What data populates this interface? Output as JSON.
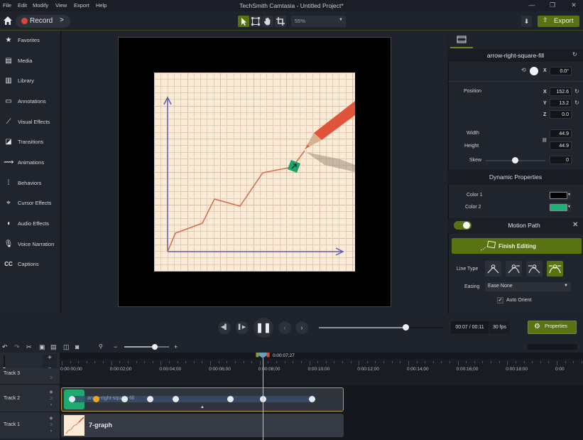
{
  "window": {
    "title": "TechSmith Camtasia - Untitled Project*",
    "menu": [
      "File",
      "Edit",
      "Modify",
      "View",
      "Export",
      "Help"
    ],
    "controls": {
      "minimize": "—",
      "restore": "❐",
      "close": "✕"
    }
  },
  "toolbar": {
    "record_label": "Record",
    "record_more": ">",
    "zoom_value": "55%",
    "export_label": "Export",
    "tools": [
      "select-tool",
      "edit-path-tool",
      "pan-tool",
      "crop-tool"
    ],
    "active_tool": "select-tool"
  },
  "sidebar": {
    "items": [
      {
        "label": "Favorites",
        "icon": "star-icon",
        "glyph": "★"
      },
      {
        "label": "Media",
        "icon": "film-icon",
        "glyph": "▤"
      },
      {
        "label": "Library",
        "icon": "library-icon",
        "glyph": "▥"
      },
      {
        "label": "Annotations",
        "icon": "annotation-icon",
        "glyph": "▭"
      },
      {
        "label": "Visual Effects",
        "icon": "magic-wand-icon",
        "glyph": "⟋"
      },
      {
        "label": "Transitions",
        "icon": "transition-icon",
        "glyph": "◪"
      },
      {
        "label": "Animations",
        "icon": "animation-icon",
        "glyph": "⟿"
      },
      {
        "label": "Behaviors",
        "icon": "behaviors-icon",
        "glyph": "⁞"
      },
      {
        "label": "Cursor Effects",
        "icon": "cursor-icon",
        "glyph": "⌖"
      },
      {
        "label": "Audio Effects",
        "icon": "speaker-icon",
        "glyph": "◖"
      },
      {
        "label": "Voice Narration",
        "icon": "microphone-icon",
        "glyph": "🎙"
      },
      {
        "label": "Captions",
        "icon": "captions-icon",
        "glyph": "CC"
      }
    ]
  },
  "properties": {
    "title": "arrow-right-square-fill",
    "rotation": {
      "axis": "X",
      "value": "0.0°"
    },
    "position": {
      "label": "Position",
      "x": "152.6",
      "y": "13.2",
      "z": "0.0"
    },
    "width": {
      "label": "Width",
      "value": "44.9"
    },
    "height": {
      "label": "Height",
      "value": "44.9"
    },
    "skew": {
      "label": "Skew",
      "value": "0",
      "slider_fraction": 0.5
    },
    "dynamic_title": "Dynamic Properties",
    "color1": {
      "label": "Color 1",
      "value": "#000000"
    },
    "color2": {
      "label": "Color 2",
      "value": "#1fb17a"
    }
  },
  "motion_path": {
    "title": "Motion Path",
    "enabled": true,
    "finish_label": "Finish Editing",
    "line_type_label": "Line Type",
    "line_types": [
      "angle",
      "curve-start",
      "curve-end",
      "smooth"
    ],
    "active_line_type": 3,
    "easing_label": "Easing",
    "easing_value": "Ease None",
    "auto_orient_label": "Auto Orient",
    "auto_orient": true
  },
  "playback": {
    "time": "00:07 / 00:11",
    "fps": "30 fps",
    "progress": 0.7,
    "properties_label": "Properties"
  },
  "timeline": {
    "zoom_fraction": 0.68,
    "playhead_time": "0:00:07;27",
    "ticks": [
      "0:00:00;00",
      "0:00:02;00",
      "0:00:04;00",
      "0:00:06;00",
      "0:00:08;00",
      "0:00:10;00",
      "0:00:12;00",
      "0:00:14;00",
      "0:00:16;00",
      "0:00:18;00",
      "0:00"
    ],
    "tracks": [
      {
        "name": "Track 3"
      },
      {
        "name": "Track 2",
        "clip": "arrow-right-square-fill"
      },
      {
        "name": "Track 1",
        "clip": "7-graph"
      }
    ]
  },
  "colors": {
    "accent": "#5a7312",
    "record": "#e0453a",
    "clip_border": "#c09a3a",
    "clip_icon": "#1faa71"
  }
}
